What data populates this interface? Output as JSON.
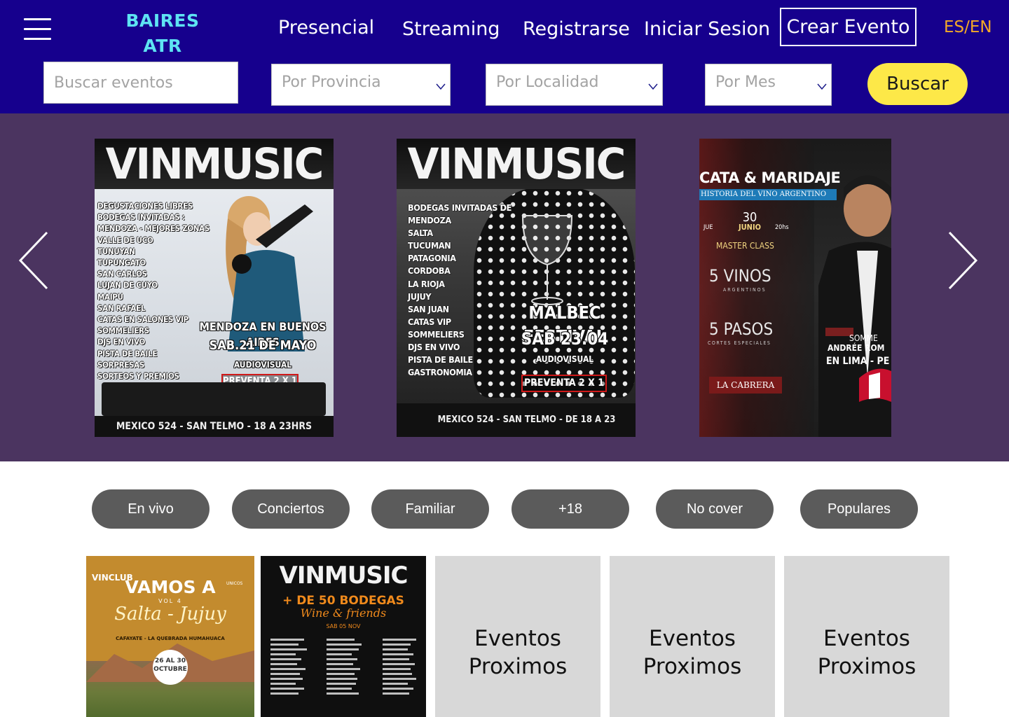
{
  "header": {
    "logo_line1": "BAIRES",
    "logo_line2": "ATR",
    "nav": {
      "presencial": "Presencial",
      "streaming": "Streaming",
      "registrarse": "Registrarse",
      "iniciar_sesion": "Iniciar Sesion"
    },
    "create_event": "Crear Evento",
    "language": "ES/EN"
  },
  "search": {
    "placeholder": "Buscar eventos",
    "province_placeholder": "Por Provincia",
    "locality_placeholder": "Por Localidad",
    "month_placeholder": "Por Mes",
    "button": "Buscar"
  },
  "carousel": {
    "slides": [
      {
        "title": "VINMUSIC",
        "list": "DEGUSTACIONES LIBRES\nBODEGAS INVITADAS :\nMENDOZA - MEJORES ZONAS\nVALLE DE UCO\nTUNUYAN\nTUPUNGATO\nSAN CARLOS\nLUJAN DE CUYO\nMAIPU\nSAN RAFAEL\nCATAS EN SALONES VIP\nSOMMELIERS\nDJS EN VIVO\nPISTA DE BAILE\nSORPRESAS\nSORTEOS Y PREMIOS",
        "headline1": "MENDOZA EN BUENOS AIRES",
        "headline2": "SAB.21 DE MAYO",
        "subline": "AUDIOVISUAL",
        "presale": "PREVENTA 2 X 1",
        "footer": "MEXICO 524 - SAN TELMO - 18 A 23HRS"
      },
      {
        "title": "VINMUSIC",
        "list": "BODEGAS INVITADAS DE\nMENDOZA\nSALTA\nTUCUMAN\nPATAGONIA\nCORDOBA\nLA RIOJA\nJUJUY\nSAN JUAN\nCATAS VIP\nSOMMELIERS\nDJS EN VIVO\nPISTA DE BAILE\nGASTRONOMIA",
        "headline1": "MALBEC FESTIVAL",
        "headline2": "SAB 23.04",
        "subline": "AUDIOVISUAL",
        "presale": "PREVENTA 2 X 1",
        "footer": "MEXICO 524 - SAN TELMO - DE 18 A 23"
      },
      {
        "title": "CATA & MARIDAJE",
        "subtitle": "HISTORIA DEL VINO ARGENTINO",
        "day": "30",
        "month": "JUNIO",
        "weekday": "JUE",
        "time": "20hs",
        "class": "MASTER CLASS",
        "wines": "5 VINOS",
        "wines_sub": "ARGENTINOS",
        "steps": "5 PASOS",
        "steps_sub": "CORTES ESPECIALES",
        "venue": "LA CABRERA",
        "sommelier_role": "SOMME",
        "sommelier_name": "ANDRÉE ROM",
        "location": "EN LIMA - PE"
      }
    ]
  },
  "categories": [
    "En vivo",
    "Conciertos",
    "Familiar",
    "+18",
    "No cover",
    "Populares"
  ],
  "events": {
    "card1": {
      "brand": "VINCLUB",
      "title": "VAMOS A",
      "vol": "VOL 4",
      "script": "Salta - Jujuy",
      "places": "CAFAYATE - LA QUEBRADA HUMAHUACA",
      "dates": "26 AL 30 OCTUBRE",
      "partner": "UNICOS"
    },
    "card2": {
      "title": "VINMUSIC",
      "headline": "+ DE 50 BODEGAS",
      "script": "Wine & friends",
      "date": "SAB 05 NOV"
    },
    "upcoming_label": "Eventos Proximos"
  },
  "colors": {
    "header_bg": "#16008d",
    "logo": "#5ee3f2",
    "language": "#f4a928",
    "search_button": "#fde848",
    "carousel_bg": "#4b3460",
    "pill_bg": "#5b5b5b",
    "placeholder_card": "#d8d8d8"
  }
}
